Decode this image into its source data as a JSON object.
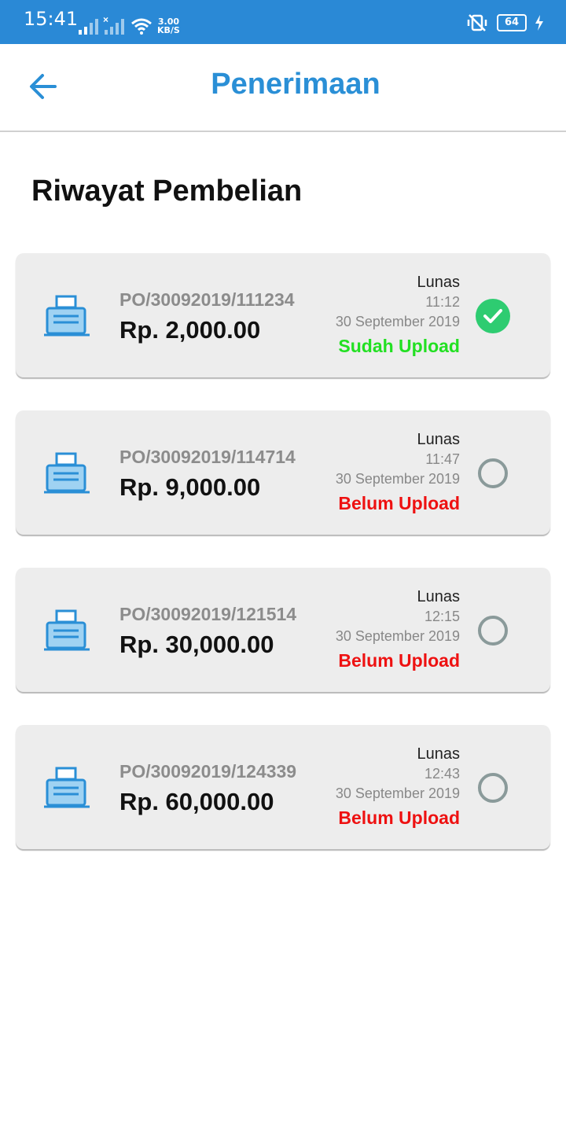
{
  "status_bar": {
    "time": "15:41",
    "speed_value": "3.00",
    "speed_unit": "KB/S",
    "battery": "64"
  },
  "header": {
    "title": "Penerimaan",
    "back_icon": "arrow-left-icon"
  },
  "section_title": "Riwayat Pembelian",
  "colors": {
    "accent": "#2a8fd6",
    "status_bar": "#2a89d6",
    "uploaded": "#22e022",
    "not_uploaded": "#ee1111",
    "check_fill": "#2ecc71",
    "unchecked_ring": "#8a9a9a"
  },
  "orders": [
    {
      "po": "PO/30092019/111234",
      "amount": "Rp. 2,000.00",
      "status": "Lunas",
      "time": "11:12",
      "date": "30 September 2019",
      "upload": "Sudah Upload",
      "uploaded": true
    },
    {
      "po": "PO/30092019/114714",
      "amount": "Rp. 9,000.00",
      "status": "Lunas",
      "time": "11:47",
      "date": "30 September 2019",
      "upload": "Belum Upload",
      "uploaded": false
    },
    {
      "po": "PO/30092019/121514",
      "amount": "Rp. 30,000.00",
      "status": "Lunas",
      "time": "12:15",
      "date": "30 September 2019",
      "upload": "Belum Upload",
      "uploaded": false
    },
    {
      "po": "PO/30092019/124339",
      "amount": "Rp. 60,000.00",
      "status": "Lunas",
      "time": "12:43",
      "date": "30 September 2019",
      "upload": "Belum Upload",
      "uploaded": false
    }
  ]
}
